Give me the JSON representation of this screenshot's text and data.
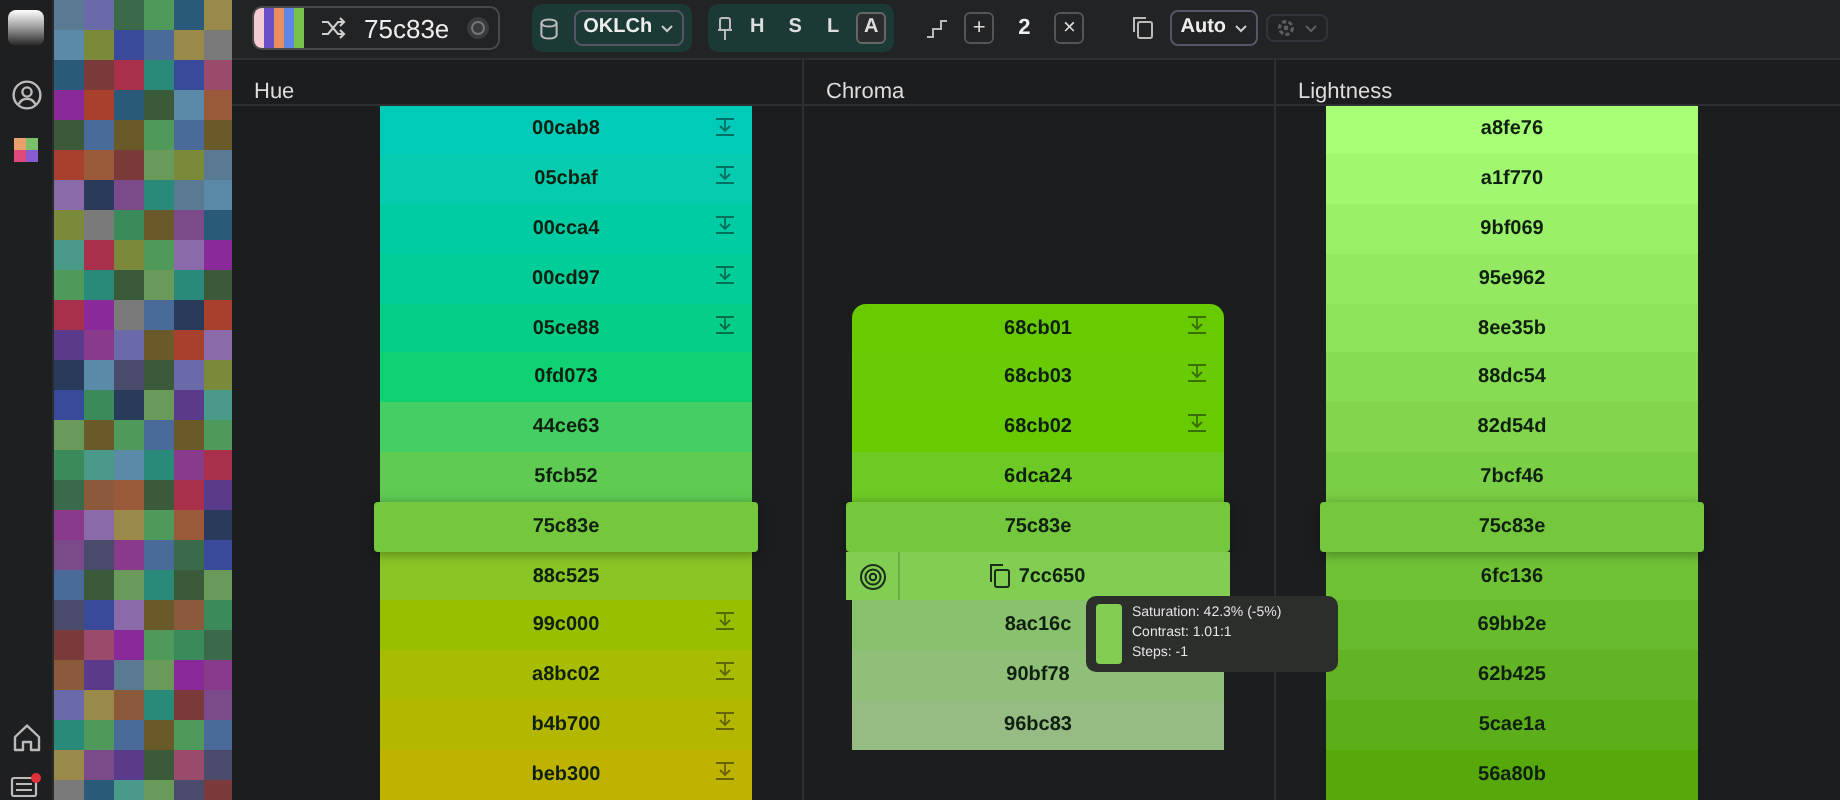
{
  "sidebar": {
    "has_notification": true
  },
  "toolbar": {
    "palette_stripes": [
      {
        "color": "#f3cbd3"
      },
      {
        "color": "#6a4fc8"
      },
      {
        "color": "#e98f5f"
      },
      {
        "color": "#5f86e6"
      },
      {
        "color": "#76c24a"
      }
    ],
    "hex_value": "75c83e",
    "color_space": "OKLCh",
    "channels": [
      {
        "label": "H",
        "selected": false
      },
      {
        "label": "S",
        "selected": false
      },
      {
        "label": "L",
        "selected": false
      },
      {
        "label": "A",
        "selected": true
      }
    ],
    "steps": "2",
    "plus_label": "+",
    "clear_label": "×",
    "contrast_mode": "Auto",
    "gear_disabled": true
  },
  "columns": [
    {
      "title": "Hue",
      "rows": [
        {
          "hex": "00cab8",
          "color": "#00cab8",
          "selected": false,
          "clamped": true
        },
        {
          "hex": "05cbaf",
          "color": "#05cbaf",
          "selected": false,
          "clamped": true
        },
        {
          "hex": "00cca4",
          "color": "#00cca4",
          "selected": false,
          "clamped": true
        },
        {
          "hex": "00cd97",
          "color": "#00cd97",
          "selected": false,
          "clamped": true
        },
        {
          "hex": "05ce88",
          "color": "#05ce88",
          "selected": false,
          "clamped": true
        },
        {
          "hex": "0fd073",
          "color": "#0fd073",
          "selected": false,
          "clamped": false
        },
        {
          "hex": "44ce63",
          "color": "#44ce63",
          "selected": false,
          "clamped": false
        },
        {
          "hex": "5fcb52",
          "color": "#5fcb52",
          "selected": false,
          "clamped": false
        },
        {
          "hex": "75c83e",
          "color": "#75c83e",
          "selected": true,
          "clamped": false
        },
        {
          "hex": "88c525",
          "color": "#88c525",
          "selected": false,
          "clamped": false
        },
        {
          "hex": "99c000",
          "color": "#99c000",
          "selected": false,
          "clamped": true
        },
        {
          "hex": "a8bc02",
          "color": "#a8bc02",
          "selected": false,
          "clamped": true
        },
        {
          "hex": "b4b700",
          "color": "#b4b700",
          "selected": false,
          "clamped": true
        },
        {
          "hex": "beb300",
          "color": "#beb300",
          "selected": false,
          "clamped": true
        }
      ]
    },
    {
      "title": "Chroma",
      "rows": [
        {
          "hex": "68cb01",
          "color": "#68cb01",
          "selected": false,
          "clamped": true,
          "hovered": false
        },
        {
          "hex": "68cb03",
          "color": "#68cb03",
          "selected": false,
          "clamped": true,
          "hovered": false
        },
        {
          "hex": "68cb02",
          "color": "#68cb02",
          "selected": false,
          "clamped": true,
          "hovered": false
        },
        {
          "hex": "6dca24",
          "color": "#6dca24",
          "selected": false,
          "clamped": false,
          "hovered": false
        },
        {
          "hex": "75c83e",
          "color": "#75c83e",
          "selected": true,
          "clamped": false,
          "hovered": false
        },
        {
          "hex": "7cc650",
          "color": "#7cc650",
          "selected": false,
          "clamped": false,
          "hovered": true
        },
        {
          "hex": "8ac16c",
          "color": "#8ac16c",
          "selected": false,
          "clamped": false,
          "hovered": false
        },
        {
          "hex": "90bf78",
          "color": "#90bf78",
          "selected": false,
          "clamped": false,
          "hovered": false
        },
        {
          "hex": "96bc83",
          "color": "#96bc83",
          "selected": false,
          "clamped": false,
          "hovered": false
        }
      ],
      "tooltip": {
        "color": "#7cc650",
        "lines": [
          "Saturation: 42.3% (-5%)",
          "Contrast: 1.01:1",
          "Steps: -1"
        ]
      }
    },
    {
      "title": "Lightness",
      "rows": [
        {
          "hex": "a8fe76",
          "color": "#a8fe76",
          "selected": false,
          "clamped": false
        },
        {
          "hex": "a1f770",
          "color": "#a1f770",
          "selected": false,
          "clamped": false
        },
        {
          "hex": "9bf069",
          "color": "#9bf069",
          "selected": false,
          "clamped": false
        },
        {
          "hex": "95e962",
          "color": "#95e962",
          "selected": false,
          "clamped": false
        },
        {
          "hex": "8ee35b",
          "color": "#8ee35b",
          "selected": false,
          "clamped": false
        },
        {
          "hex": "88dc54",
          "color": "#88dc54",
          "selected": false,
          "clamped": false
        },
        {
          "hex": "82d54d",
          "color": "#82d54d",
          "selected": false,
          "clamped": false
        },
        {
          "hex": "7bcf46",
          "color": "#7bcf46",
          "selected": false,
          "clamped": false
        },
        {
          "hex": "75c83e",
          "color": "#75c83e",
          "selected": true,
          "clamped": false
        },
        {
          "hex": "6fc136",
          "color": "#6fc136",
          "selected": false,
          "clamped": false
        },
        {
          "hex": "69bb2e",
          "color": "#69bb2e",
          "selected": false,
          "clamped": false
        },
        {
          "hex": "62b425",
          "color": "#62b425",
          "selected": false,
          "clamped": false
        },
        {
          "hex": "5cae1a",
          "color": "#5cae1a",
          "selected": false,
          "clamped": false
        },
        {
          "hex": "56a80b",
          "color": "#56a80b",
          "selected": false,
          "clamped": false
        }
      ]
    }
  ]
}
